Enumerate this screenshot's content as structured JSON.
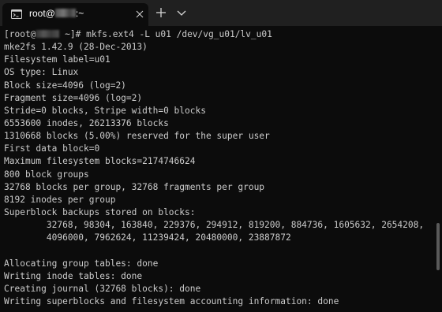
{
  "tab": {
    "title_prefix": "root@",
    "title_suffix": ":~",
    "icon": "terminal-icon"
  },
  "toolbar": {
    "close_icon": "close-icon",
    "new_tab_icon": "plus-icon",
    "dropdown_icon": "chevron-down-icon"
  },
  "terminal": {
    "prompt_prefix": "[root@",
    "prompt_suffix": " ~]# mkfs.ext4 -L u01 /dev/vg_u01/lv_u01",
    "lines": [
      "mke2fs 1.42.9 (28-Dec-2013)",
      "Filesystem label=u01",
      "OS type: Linux",
      "Block size=4096 (log=2)",
      "Fragment size=4096 (log=2)",
      "Stride=0 blocks, Stripe width=0 blocks",
      "6553600 inodes, 26213376 blocks",
      "1310668 blocks (5.00%) reserved for the super user",
      "First data block=0",
      "Maximum filesystem blocks=2174746624",
      "800 block groups",
      "32768 blocks per group, 32768 fragments per group",
      "8192 inodes per group",
      "Superblock backups stored on blocks:",
      "\t32768, 98304, 163840, 229376, 294912, 819200, 884736, 1605632, 2654208,",
      "\t4096000, 7962624, 11239424, 20480000, 23887872",
      "",
      "Allocating group tables: done",
      "Writing inode tables: done",
      "Creating journal (32768 blocks): done",
      "Writing superblocks and filesystem accounting information: done"
    ]
  },
  "colors": {
    "background": "#0c0c0c",
    "tabstrip": "#202020",
    "text": "#cccccc"
  }
}
